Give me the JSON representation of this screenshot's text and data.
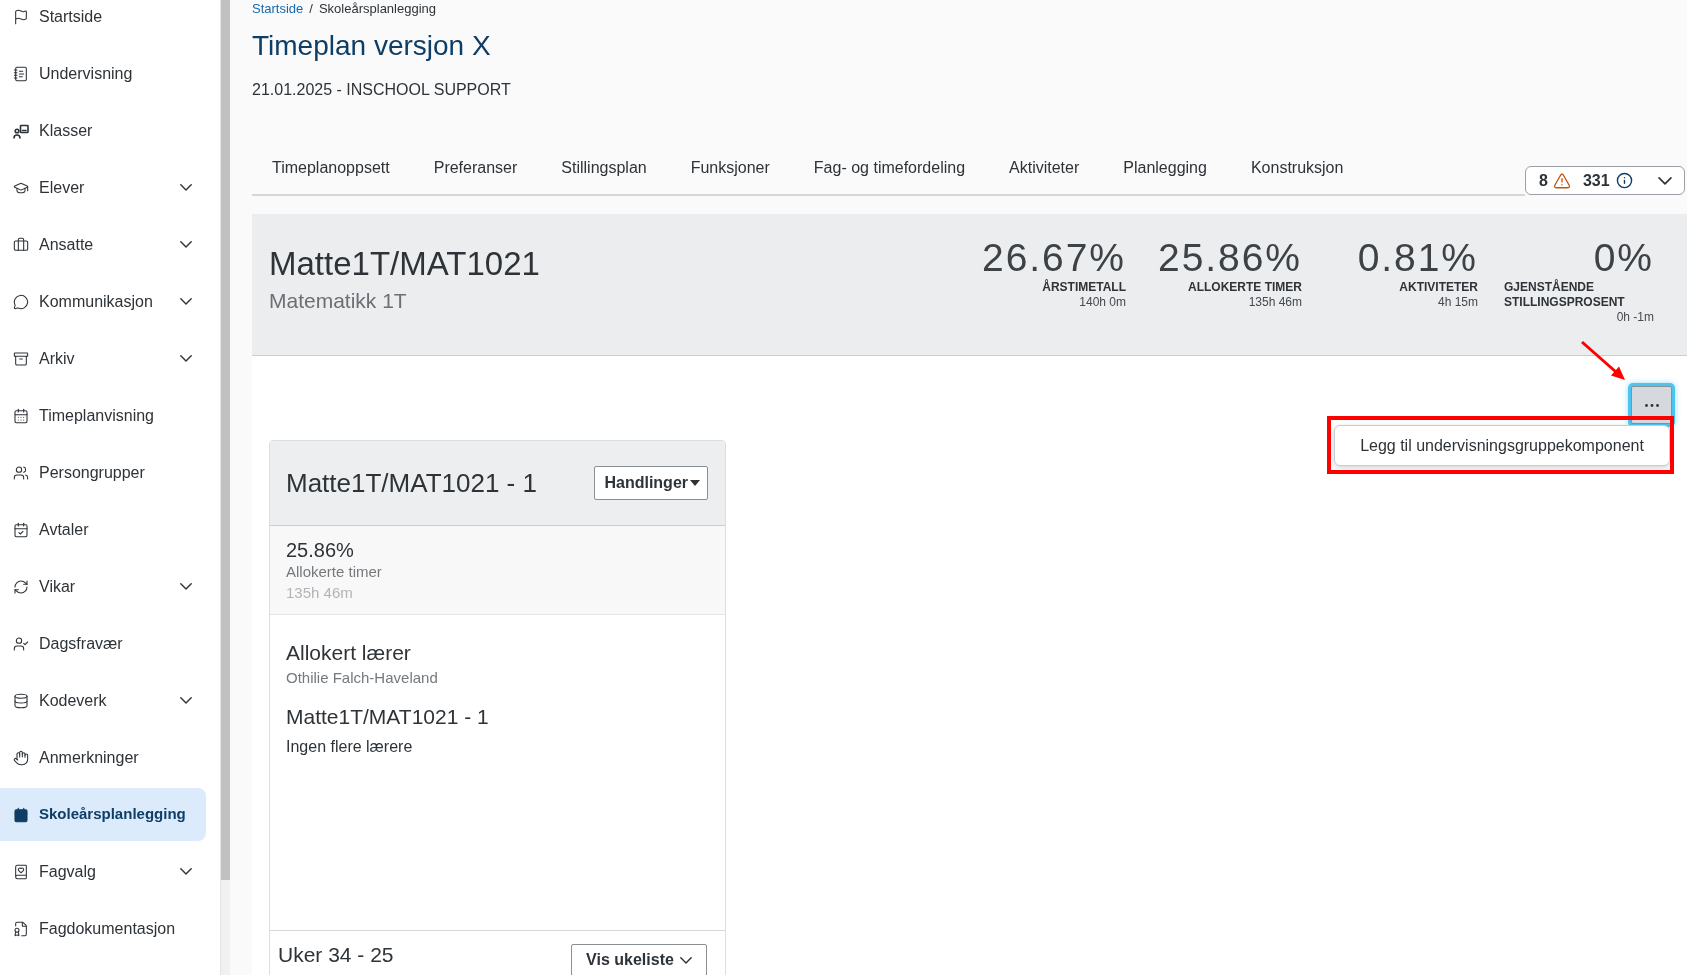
{
  "sidebar": {
    "items": [
      {
        "label": "Startside",
        "kind": "link",
        "selected": false
      },
      {
        "label": "Undervisning",
        "kind": "link",
        "selected": false
      },
      {
        "label": "Klasser",
        "kind": "link",
        "selected": false
      },
      {
        "label": "Elever",
        "kind": "group",
        "selected": false
      },
      {
        "label": "Ansatte",
        "kind": "group",
        "selected": false
      },
      {
        "label": "Kommunikasjon",
        "kind": "group",
        "selected": false
      },
      {
        "label": "Arkiv",
        "kind": "group",
        "selected": false
      },
      {
        "label": "Timeplanvisning",
        "kind": "link",
        "selected": false
      },
      {
        "label": "Persongrupper",
        "kind": "link",
        "selected": false
      },
      {
        "label": "Avtaler",
        "kind": "link",
        "selected": false
      },
      {
        "label": "Vikar",
        "kind": "group",
        "selected": false
      },
      {
        "label": "Dagsfravær",
        "kind": "link",
        "selected": false
      },
      {
        "label": "Kodeverk",
        "kind": "group",
        "selected": false
      },
      {
        "label": "Anmerkninger",
        "kind": "link",
        "selected": false
      },
      {
        "label": "Skoleårsplanlegging",
        "kind": "link",
        "selected": true
      },
      {
        "label": "Fagvalg",
        "kind": "group",
        "selected": false
      },
      {
        "label": "Fagdokumentasjon",
        "kind": "link",
        "selected": false
      }
    ]
  },
  "breadcrumb": {
    "separator": "/",
    "items": [
      {
        "label": "Startside",
        "kind": "link"
      },
      {
        "label": "Skoleårsplanlegging",
        "kind": "current"
      }
    ]
  },
  "page": {
    "title": "Timeplan versjon X",
    "subtitle": "21.01.2025 - INSCHOOL SUPPORT"
  },
  "tabs": [
    {
      "label": "Timeplanoppsett",
      "selected": false
    },
    {
      "label": "Preferanser",
      "selected": false
    },
    {
      "label": "Stillingsplan",
      "selected": false
    },
    {
      "label": "Funksjoner",
      "selected": false
    },
    {
      "label": "Fag- og timefordeling",
      "selected": false
    },
    {
      "label": "Aktiviteter",
      "selected": false
    },
    {
      "label": "Planlegging",
      "selected": false
    },
    {
      "label": "Konstruksjon",
      "selected": false
    }
  ],
  "status_badge": {
    "warnings": "8",
    "info": "331",
    "expanded": false
  },
  "summary": {
    "code": "Matte1T/MAT1021",
    "name": "Matematikk 1T",
    "stats": [
      {
        "value": "26.67%",
        "label": "ÅRSTIMETALL",
        "detail": "140h 0m"
      },
      {
        "value": "25.86%",
        "label": "ALLOKERTE TIMER",
        "detail": "135h 46m"
      },
      {
        "value": "0.81%",
        "label": "AKTIVITETER",
        "detail": "4h 15m"
      },
      {
        "value": "0%",
        "label": "GJENSTÅENDE STILLINGSPROSENT",
        "detail": "0h -1m"
      }
    ]
  },
  "more_menu": {
    "expanded": true,
    "items": [
      {
        "label": "Legg til undervisningsgruppekomponent"
      }
    ]
  },
  "annotations": {
    "arrow": true,
    "highlight_frame": true
  },
  "group_card": {
    "title": "Matte1T/MAT1021 - 1",
    "actions_button": "Handlinger",
    "allocation": {
      "value": "25.86%",
      "label": "Allokerte timer",
      "detail": "135h 46m"
    },
    "teacher_heading": "Allokert lærer",
    "teacher_name": "Othilie Falch-Haveland",
    "group_name": "Matte1T/MAT1021 - 1",
    "other_teachers": "Ingen flere lærere",
    "weeks": "Uker 34 - 25",
    "weeks_button": "Vis ukeliste"
  }
}
